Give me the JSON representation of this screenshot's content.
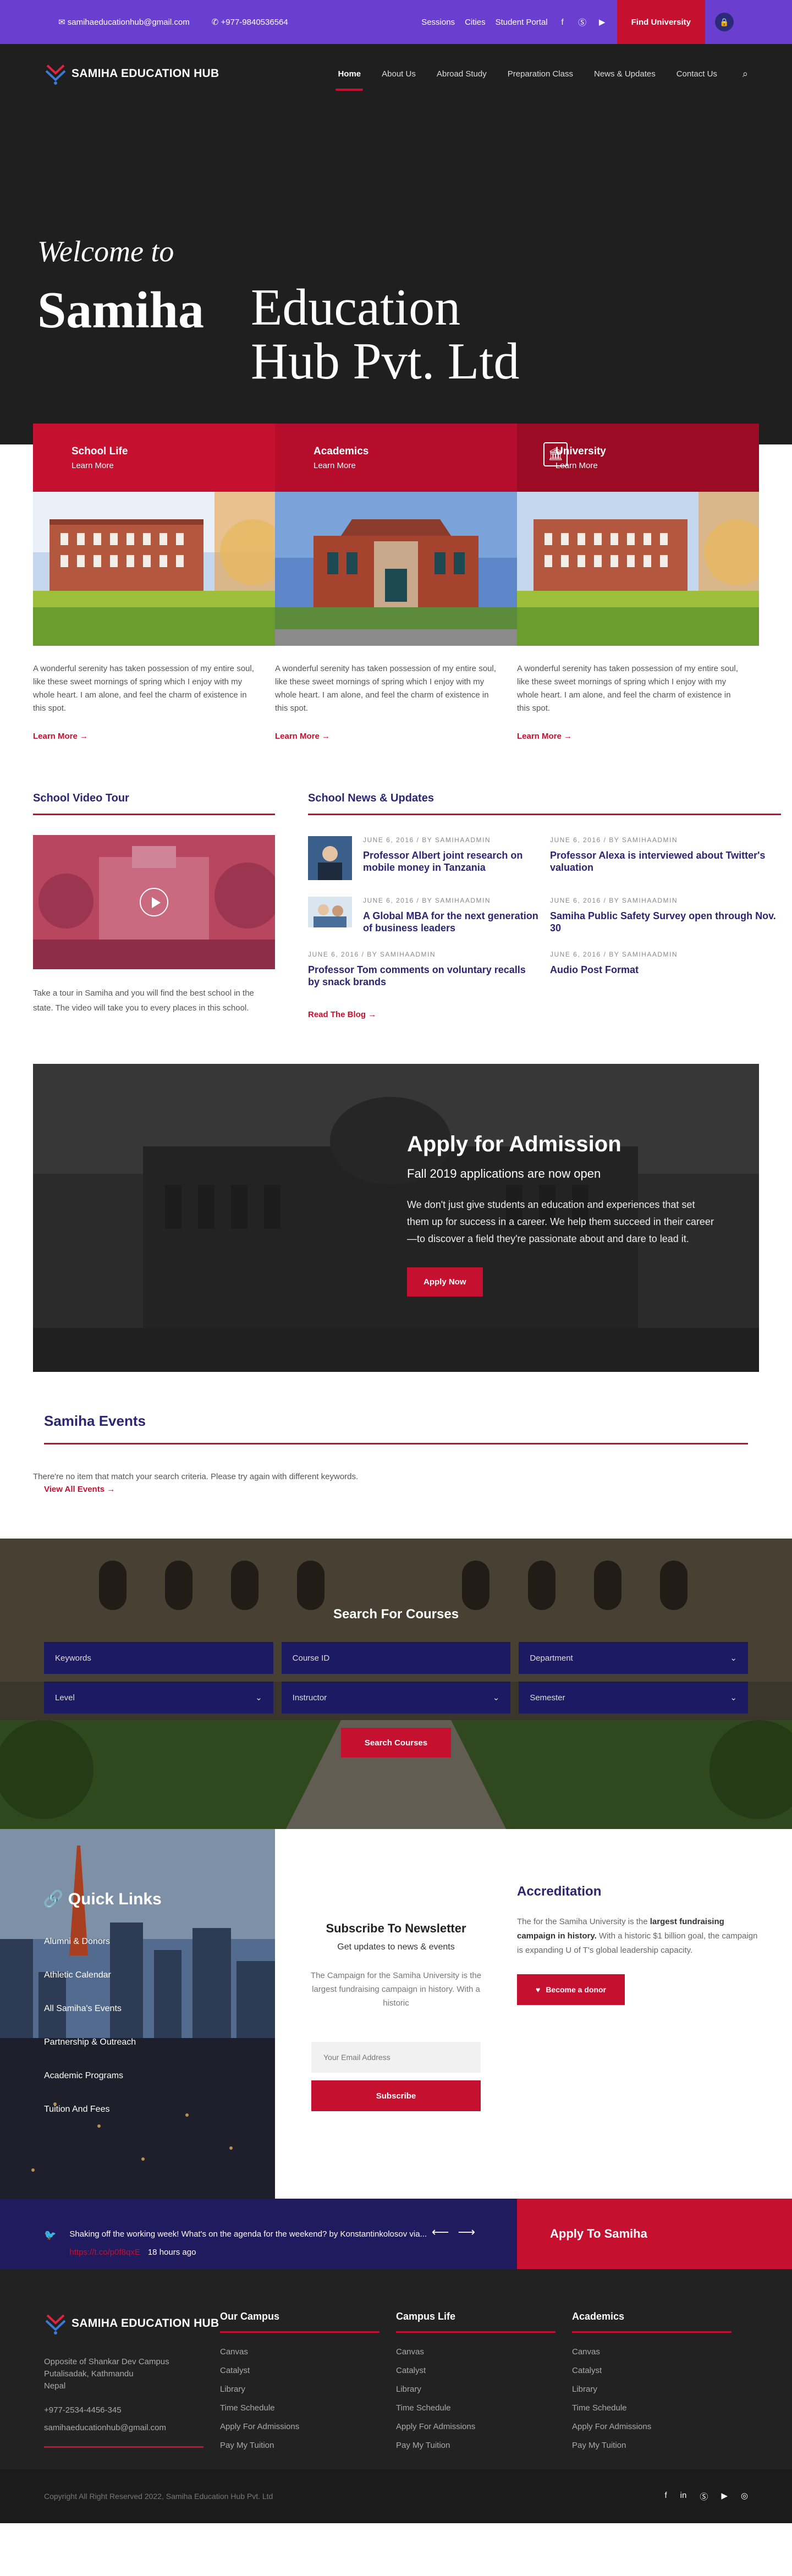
{
  "topbar": {
    "email": "samihaeducationhub@gmail.com",
    "phone": "+977-9840536564",
    "links": [
      "Sessions",
      "Cities",
      "Student Portal"
    ],
    "social_icons": [
      "facebook-icon",
      "skype-icon",
      "youtube-icon"
    ],
    "cta": "Find University"
  },
  "nav": {
    "brand": "SAMIHA EDUCATION HUB",
    "items": [
      "Home",
      "About Us",
      "Abroad Study",
      "Preparation Class",
      "News & Updates",
      "Contact Us"
    ]
  },
  "hero": {
    "welcome": "Welcome to",
    "name": "Samiha",
    "rest_line1": "Education",
    "rest_line2": "Hub Pvt. Ltd"
  },
  "cards": [
    {
      "title": "School Life",
      "sub": "Learn More",
      "text": "A wonderful serenity has taken possession of my entire soul, like these sweet mornings of spring which I enjoy with my whole heart. I am alone, and feel the charm of existence in this spot.",
      "link": "Learn More",
      "color": "#c5102f"
    },
    {
      "title": "Academics",
      "sub": "Learn More",
      "text": "A wonderful serenity has taken possession of my entire soul, like these sweet mornings of spring which I enjoy with my whole heart. I am alone, and feel the charm of existence in this spot.",
      "link": "Learn More",
      "color": "#b50d2b"
    },
    {
      "title": "University",
      "sub": "Learn More",
      "text": "A wonderful serenity has taken possession of my entire soul, like these sweet mornings of spring which I enjoy with my whole heart. I am alone, and feel the charm of existence in this spot.",
      "link": "Learn More",
      "color": "#9c0b24"
    }
  ],
  "tour": {
    "title": "School Video Tour",
    "text": "Take a tour in Samiha and you will find the best school in the state. The video will take you to every places in this school."
  },
  "news": {
    "title": "School News & Updates",
    "items": [
      {
        "meta": "JUNE 6, 2016  /  BY  SAMIHAADMIN",
        "title": "Professor Albert joint research on mobile money in Tanzania",
        "thumb": true
      },
      {
        "meta": "JUNE 6, 2016  /  BY  SAMIHAADMIN",
        "title": "Professor Alexa is interviewed about Twitter's valuation",
        "thumb": false
      },
      {
        "meta": "JUNE 6, 2016  /  BY  SAMIHAADMIN",
        "title": "A Global MBA for the next generation of business leaders",
        "thumb": true
      },
      {
        "meta": "JUNE 6, 2016  /  BY  SAMIHAADMIN",
        "title": "Samiha Public Safety Survey open through Nov. 30",
        "thumb": false
      },
      {
        "meta": "JUNE 6, 2016  /  BY  SAMIHAADMIN",
        "title": "Professor Tom comments on voluntary recalls by snack brands",
        "thumb": false
      },
      {
        "meta": "JUNE 6, 2016  /  BY  SAMIHAADMIN",
        "title": "Audio Post Format",
        "thumb": false
      }
    ],
    "read_blog": "Read The Blog"
  },
  "admission": {
    "title": "Apply for Admission",
    "sub": "Fall 2019 applications are now open",
    "text": "We don't just give students an education and experiences that set them up for success in a career. We help them succeed in their career—to discover a field they're passionate about and dare to lead it.",
    "button": "Apply Now"
  },
  "events": {
    "title": "Samiha Events",
    "empty": "There're no item that match your search criteria. Please try again with different keywords.",
    "view_all": "View All Events"
  },
  "courses": {
    "title": "Search For Courses",
    "fields": [
      {
        "label": "Keywords",
        "select": false
      },
      {
        "label": "Course ID",
        "select": false
      },
      {
        "label": "Department",
        "select": true
      },
      {
        "label": "Level",
        "select": true
      },
      {
        "label": "Instructor",
        "select": true
      },
      {
        "label": "Semester",
        "select": true
      }
    ],
    "button": "Search Courses"
  },
  "quicklinks": {
    "title": "Quick Links",
    "items": [
      "Alumni & Donors",
      "Athletic Calendar",
      "All Samiha's Events",
      "Partnership & Outreach",
      "Academic Programs",
      "Tuition And Fees"
    ]
  },
  "newsletter": {
    "title": "Subscribe To Newsletter",
    "sub": "Get updates to news & events",
    "text": "The Campaign for the Samiha University is the largest fundraising campaign in history. With a historic",
    "placeholder": "Your Email Address",
    "button": "Subscribe"
  },
  "accreditation": {
    "title": "Accreditation",
    "text_pre": "The for the Samiha University is the ",
    "text_bold": "largest fundraising campaign in history.",
    "text_post": " With a historic $1 billion goal, the campaign is expanding U of T's global leadership capacity.",
    "button": "Become a donor"
  },
  "tweet": {
    "text": "Shaking off the working week! What's on the agenda for the weekend? by Konstantinkolosov via...",
    "handle": "https://t.co/p0f8qxE",
    "time": "18 hours ago"
  },
  "apply_samiha": "Apply To Samiha",
  "footer": {
    "brand": "SAMIHA EDUCATION HUB",
    "address": [
      "Opposite of Shankar Dev Campus",
      "Putalisadak, Kathmandu",
      "Nepal"
    ],
    "phone": "+977-2534-4456-345",
    "email": "samihaeducationhub@gmail.com",
    "columns": [
      {
        "title": "Our Campus",
        "items": [
          "Canvas",
          "Catalyst",
          "Library",
          "Time Schedule",
          "Apply For Admissions",
          "Pay My Tuition"
        ]
      },
      {
        "title": "Campus Life",
        "items": [
          "Canvas",
          "Catalyst",
          "Library",
          "Time Schedule",
          "Apply For Admissions",
          "Pay My Tuition"
        ]
      },
      {
        "title": "Academics",
        "items": [
          "Canvas",
          "Catalyst",
          "Library",
          "Time Schedule",
          "Apply For Admissions",
          "Pay My Tuition"
        ]
      }
    ],
    "copyright": "Copyright All Right Reserved 2022, Samiha Education Hub Pvt. Ltd"
  },
  "colors": {
    "accent": "#c5102f",
    "brand": "#2b2572",
    "topbar": "#6a3fd0"
  }
}
